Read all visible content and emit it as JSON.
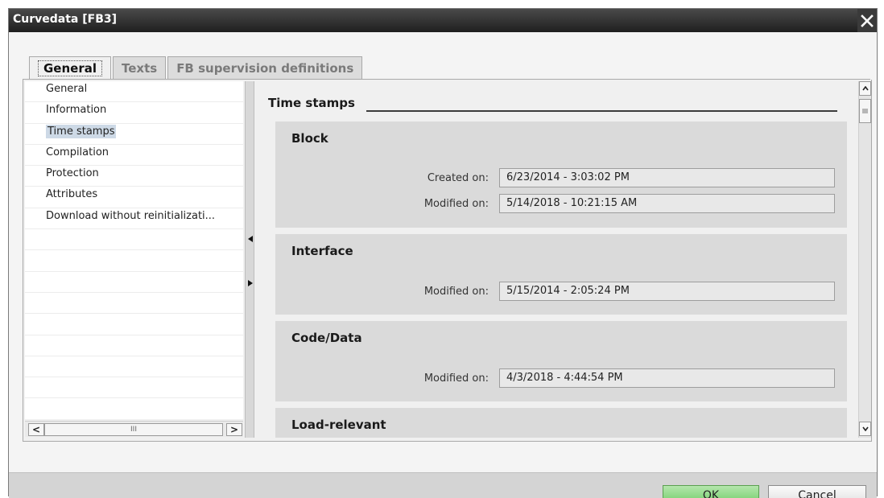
{
  "window": {
    "title": "Curvedata [FB3]",
    "close_glyph": "✕"
  },
  "tabs": [
    {
      "label": "General",
      "active": true
    },
    {
      "label": "Texts",
      "active": false
    },
    {
      "label": "FB supervision definitions",
      "active": false
    }
  ],
  "nav": {
    "items": [
      {
        "label": "General"
      },
      {
        "label": "Information"
      },
      {
        "label": "Time stamps",
        "selected": true
      },
      {
        "label": "Compilation"
      },
      {
        "label": "Protection"
      },
      {
        "label": "Attributes"
      },
      {
        "label": "Download without reinitializati..."
      }
    ],
    "scroll_left": "<",
    "scroll_right": ">",
    "scroll_grip": "III"
  },
  "main": {
    "section_title": "Time stamps",
    "groups": [
      {
        "title": "Block",
        "fields": [
          {
            "label": "Created on:",
            "value": "6/23/2014 - 3:03:02 PM"
          },
          {
            "label": "Modified on:",
            "value": "5/14/2018 - 10:21:15 AM"
          }
        ]
      },
      {
        "title": "Interface",
        "fields": [
          {
            "label": "Modified on:",
            "value": "5/15/2014 - 2:05:24 PM"
          }
        ]
      },
      {
        "title": "Code/Data",
        "fields": [
          {
            "label": "Modified on:",
            "value": "4/3/2018 - 4:44:54 PM"
          }
        ]
      },
      {
        "title": "Load-relevant",
        "fields": []
      }
    ]
  },
  "buttons": {
    "ok": "OK",
    "cancel": "Cancel"
  },
  "colors": {
    "ok_button": "#6ccc63",
    "titlebar": "#2a2a2a",
    "selected_nav": "#cdd9e6"
  }
}
